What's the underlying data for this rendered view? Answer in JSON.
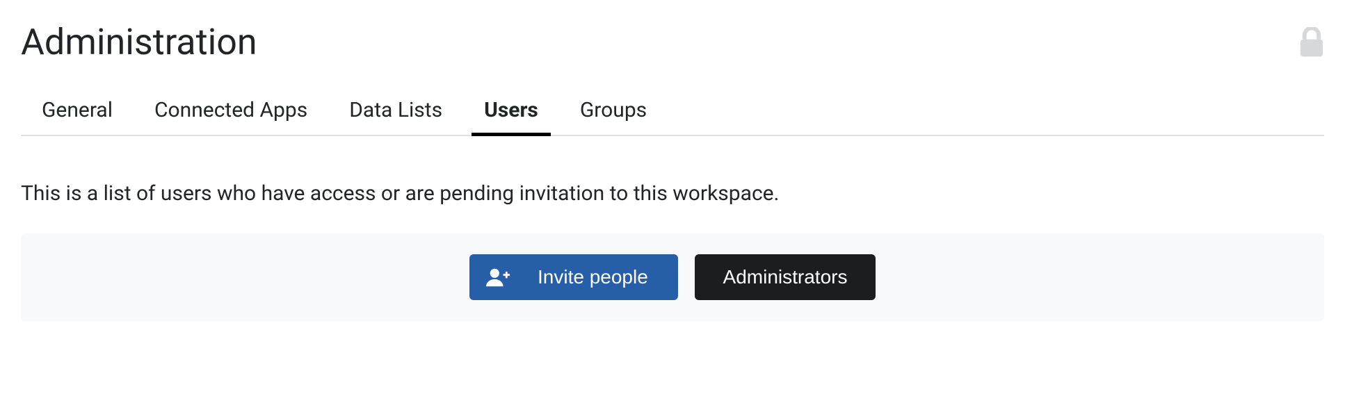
{
  "header": {
    "title": "Administration"
  },
  "tabs": {
    "general": "General",
    "connected_apps": "Connected Apps",
    "data_lists": "Data Lists",
    "users": "Users",
    "groups": "Groups"
  },
  "main": {
    "description": "This is a list of users who have access or are pending invitation to this workspace.",
    "invite_label": "Invite people",
    "admins_label": "Administrators"
  }
}
